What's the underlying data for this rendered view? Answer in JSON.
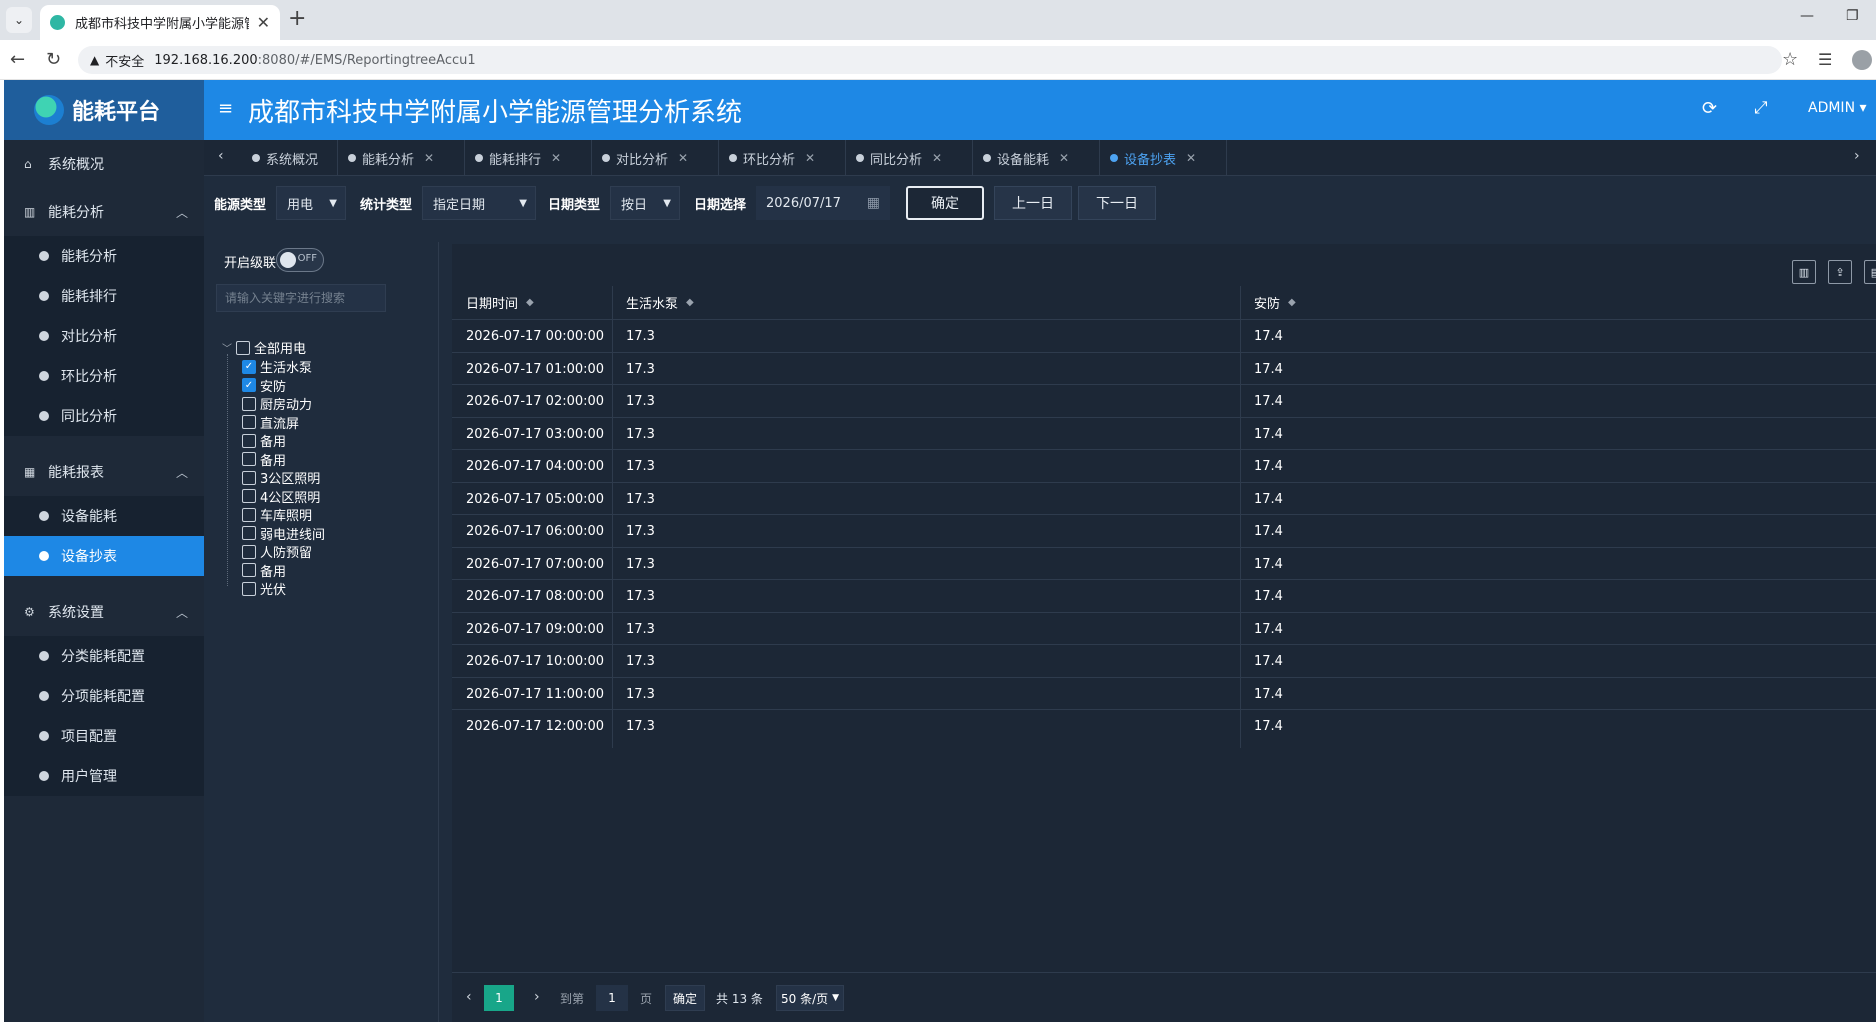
{
  "browser": {
    "tab_title": "成都市科技中学附属小学能源管理",
    "security_label": "不安全",
    "url_host": "192.168.16.200",
    "url_path": ":8080/#/EMS/ReportingtreeAccu1"
  },
  "app": {
    "logo_text": "能耗平台",
    "title": "成都市科技中学附属小学能源管理分析系统",
    "user": "ADMIN"
  },
  "sidebar": {
    "overview": "系统概况",
    "energy_analysis": {
      "label": "能耗分析",
      "items": [
        "能耗分析",
        "能耗排行",
        "对比分析",
        "环比分析",
        "同比分析"
      ]
    },
    "energy_report": {
      "label": "能耗报表",
      "items": [
        "设备能耗",
        "设备抄表"
      ]
    },
    "settings": {
      "label": "系统设置",
      "items": [
        "分类能耗配置",
        "分项能耗配置",
        "项目配置",
        "用户管理"
      ]
    }
  },
  "tags": [
    "系统概况",
    "能耗分析",
    "能耗排行",
    "对比分析",
    "环比分析",
    "同比分析",
    "设备能耗",
    "设备抄表"
  ],
  "filters": {
    "energy_type_label": "能源类型",
    "energy_type_value": "用电",
    "stat_type_label": "统计类型",
    "stat_type_value": "指定日期",
    "date_type_label": "日期类型",
    "date_type_value": "按日",
    "date_select_label": "日期选择",
    "date_value": "2026/07/17",
    "confirm": "确定",
    "prev_day": "上一日",
    "next_day": "下一日"
  },
  "tree": {
    "cascade_label": "开启级联",
    "toggle_text": "OFF",
    "search_placeholder": "请输入关键字进行搜索",
    "root": "全部用电",
    "nodes": [
      {
        "label": "生活水泵",
        "checked": true
      },
      {
        "label": "安防",
        "checked": true
      },
      {
        "label": "厨房动力",
        "checked": false
      },
      {
        "label": "直流屏",
        "checked": false
      },
      {
        "label": "备用",
        "checked": false
      },
      {
        "label": "备用",
        "checked": false
      },
      {
        "label": "3公区照明",
        "checked": false
      },
      {
        "label": "4公区照明",
        "checked": false
      },
      {
        "label": "车库照明",
        "checked": false
      },
      {
        "label": "弱电进线间",
        "checked": false
      },
      {
        "label": "人防预留",
        "checked": false
      },
      {
        "label": "备用",
        "checked": false
      },
      {
        "label": "光伏",
        "checked": false
      }
    ]
  },
  "table": {
    "columns": [
      "日期时间",
      "生活水泵",
      "安防"
    ],
    "rows": [
      [
        "2026-07-17 00:00:00",
        "17.3",
        "17.4"
      ],
      [
        "2026-07-17 01:00:00",
        "17.3",
        "17.4"
      ],
      [
        "2026-07-17 02:00:00",
        "17.3",
        "17.4"
      ],
      [
        "2026-07-17 03:00:00",
        "17.3",
        "17.4"
      ],
      [
        "2026-07-17 04:00:00",
        "17.3",
        "17.4"
      ],
      [
        "2026-07-17 05:00:00",
        "17.3",
        "17.4"
      ],
      [
        "2026-07-17 06:00:00",
        "17.3",
        "17.4"
      ],
      [
        "2026-07-17 07:00:00",
        "17.3",
        "17.4"
      ],
      [
        "2026-07-17 08:00:00",
        "17.3",
        "17.4"
      ],
      [
        "2026-07-17 09:00:00",
        "17.3",
        "17.4"
      ],
      [
        "2026-07-17 10:00:00",
        "17.3",
        "17.4"
      ],
      [
        "2026-07-17 11:00:00",
        "17.3",
        "17.4"
      ],
      [
        "2026-07-17 12:00:00",
        "17.3",
        "17.4"
      ]
    ]
  },
  "pager": {
    "current_page": "1",
    "goto_label": "到第",
    "goto_value": "1",
    "page_unit": "页",
    "confirm": "确定",
    "total": "共 13 条",
    "page_size": "50 条/页"
  },
  "colors": {
    "accent": "#1e88e5",
    "sidebar_bg": "#1e2938",
    "content_bg": "#1f2c3d",
    "pager_active": "#18a689"
  }
}
